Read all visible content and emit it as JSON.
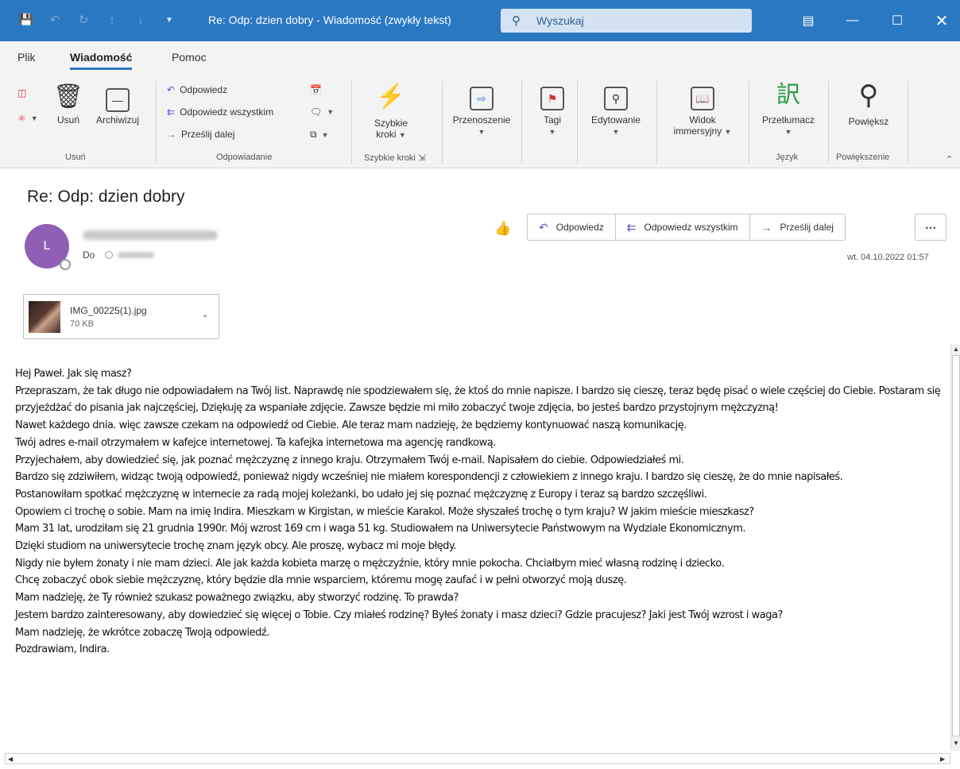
{
  "titlebar": {
    "title": "Re: Odp: dzien dobry - Wiadomość (zwykły tekst)",
    "search_placeholder": "Wyszukaj"
  },
  "tabs": [
    "Plik",
    "Wiadomość",
    "Pomoc"
  ],
  "ribbon": {
    "delete_group": {
      "label": "Usuń",
      "delete": "Usuń",
      "archive": "Archiwizuj"
    },
    "respond_group": {
      "label": "Odpowiadanie",
      "reply": "Odpowiedz",
      "reply_all": "Odpowiedz wszystkim",
      "forward": "Prześlij dalej"
    },
    "quick_steps": {
      "label": "Szybkie kroki",
      "button": "Szybkie",
      "button2": "kroki"
    },
    "move": "Przenoszenie",
    "tags": "Tagi",
    "editing": "Edytowanie",
    "immersive": {
      "line1": "Widok",
      "line2": "immersyjny"
    },
    "language": {
      "label": "Język",
      "translate": "Przetłumacz"
    },
    "zoom": {
      "label": "Powiększenie",
      "button": "Powiększ"
    }
  },
  "mail": {
    "subject": "Re: Odp: dzien dobry",
    "avatar_initial": "L",
    "to_label": "Do",
    "actions": {
      "reply": "Odpowiedz",
      "reply_all": "Odpowiedz wszystkim",
      "forward": "Prześlij dalej"
    },
    "date": "wt. 04.10.2022 01:57",
    "attachment": {
      "name": "IMG_00225(1).jpg",
      "size": "70 KB"
    },
    "body": [
      "Hej Paweł. Jak się masz?",
      "Przepraszam, że tak długo nie odpowiadałem na Twój list. Naprawdę nie spodziewałem się, że ktoś do mnie napisze. I bardzo się cieszę, teraz będę pisać o wiele częściej do Ciebie. Postaram się przyjeżdżać do pisania jak najczęściej, Dziękuję za wspaniałe zdjęcie. Zawsze będzie mi miło zobaczyć twoje zdjęcia, bo jesteś bardzo przystojnym mężczyzną!",
      "Nawet każdego dnia. więc zawsze czekam na odpowiedź od Ciebie. Ale teraz mam nadzieję, że będziemy kontynuować naszą komunikację.",
      "Twój adres e-mail otrzymałem w kafejce internetowej. Ta kafejka internetowa ma agencję randkową.",
      "Przyjechałem, aby dowiedzieć się, jak poznać mężczyznę z innego kraju. Otrzymałem Twój e-mail. Napisałem do ciebie. Odpowiedziałeś mi.",
      "Bardzo się zdziwiłem, widząc twoją odpowiedź, ponieważ nigdy wcześniej nie miałem korespondencji z człowiekiem z innego kraju. I bardzo się cieszę, że do mnie napisałeś.",
      "Postanowiłam spotkać mężczyznę w internecie za radą mojej koleżanki, bo udało jej się poznać mężczyznę z Europy i teraz są bardzo szczęśliwi.",
      "Opowiem ci trochę o sobie. Mam na imię Indira. Mieszkam w Kirgistan, w mieście Karakol. Może słyszałeś trochę o tym kraju? W jakim mieście mieszkasz?",
      "Mam 31 lat, urodziłam się 21 grudnia 1990r. Mój wzrost 169 cm i waga 51 kg. Studiowałem na Uniwersytecie Państwowym na Wydziale Ekonomicznym.",
      "Dzięki studiom na uniwersytecie trochę znam język obcy. Ale proszę, wybacz mi moje błędy.",
      "Nigdy nie byłem żonaty i nie mam dzieci. Ale jak każda kobieta marzę o mężczyźnie, który mnie pokocha. Chciałbym mieć własną rodzinę i dziecko.",
      "Chcę zobaczyć obok siebie mężczyznę, który będzie dla mnie wsparciem, któremu mogę zaufać i w pełni otworzyć moją duszę.",
      "Mam nadzieję, że Ty również szukasz poważnego związku, aby stworzyć rodzinę. To prawda?",
      "Jestem bardzo zainteresowany, aby dowiedzieć się więcej o Tobie. Czy miałeś rodzinę? Byłeś żonaty i masz dzieci? Gdzie pracujesz? Jaki jest Twój wzrost i waga?",
      "Mam nadzieję, że wkrótce zobaczę Twoją odpowiedź.",
      "Pozdrawiam, Indira."
    ]
  },
  "colors": {
    "titlebar": "#2b78c2",
    "avatar": "#8e5fb5",
    "ribbon_bg": "#f3f3f3"
  }
}
